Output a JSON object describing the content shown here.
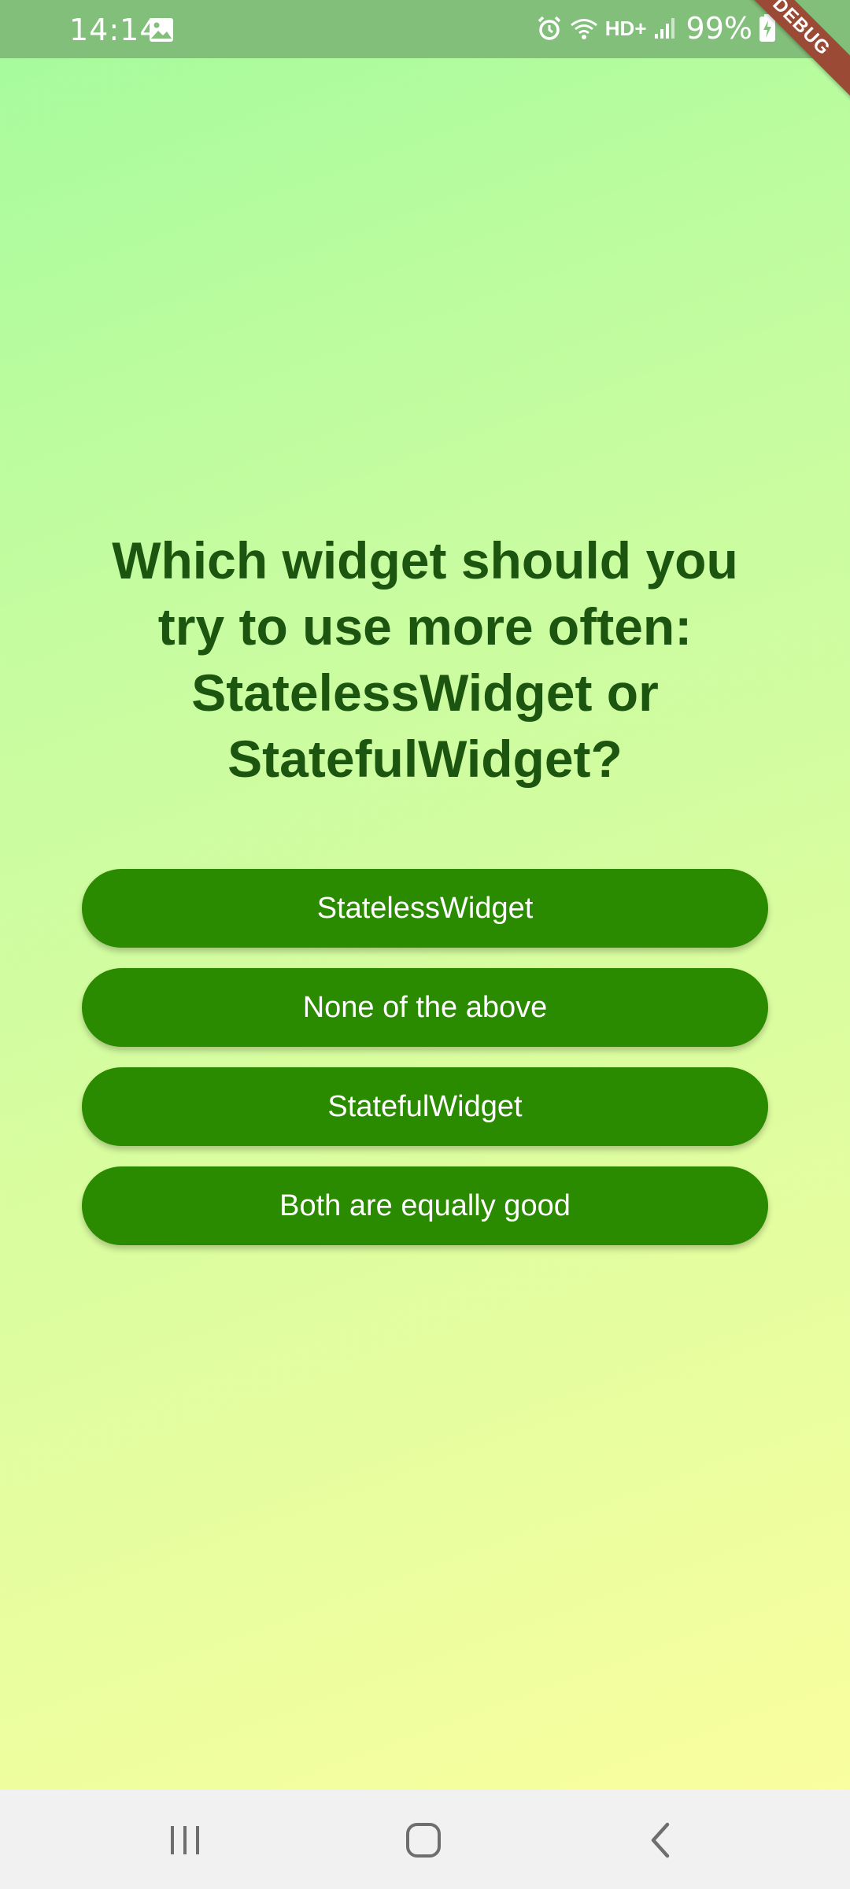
{
  "status_bar": {
    "time": "14:14",
    "network": "HD+",
    "battery": "99%",
    "icons": [
      "gallery-icon",
      "alarm-icon",
      "wifi-icon",
      "signal-icon",
      "battery-charging-icon"
    ]
  },
  "debug_banner": "DEBUG",
  "quiz": {
    "question": "Which widget should you try to use more often: StatelessWidget or StatefulWidget?",
    "answers": [
      "StatelessWidget",
      "None of the above",
      "StatefulWidget",
      "Both are equally good"
    ]
  },
  "colors": {
    "status_bar": "#82bf7b",
    "question_text": "#1c5510",
    "button": "#2a8a00",
    "button_text": "#ffffff",
    "gradient_top": "#a4fb9c",
    "gradient_bottom": "#fdfe9f",
    "nav_bar": "#f1f1f1"
  },
  "nav_bar": {
    "icons": [
      "recent-apps-icon",
      "home-icon",
      "back-icon"
    ]
  }
}
